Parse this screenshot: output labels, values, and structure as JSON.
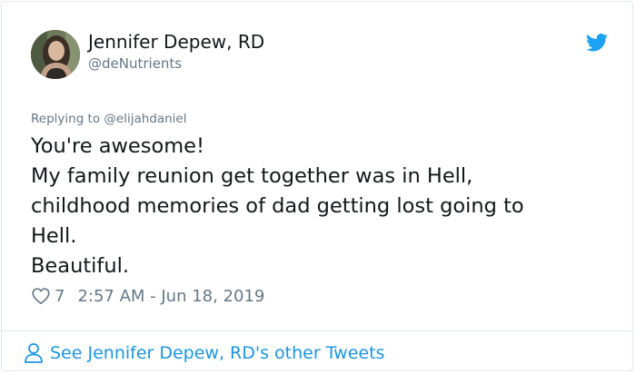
{
  "author": {
    "name": "Jennifer Depew, RD",
    "handle": "@deNutrients",
    "avatar_icon": "profile-photo"
  },
  "brand": {
    "icon": "twitter-bird-icon",
    "color": "#1da1f2"
  },
  "tweet": {
    "replying_to": "Replying to @elijahdaniel",
    "lines": [
      "You're awesome!",
      "My family reunion get together was in Hell,",
      "childhood memories of dad getting lost going to",
      "Hell.",
      "Beautiful."
    ]
  },
  "meta": {
    "like_icon": "heart-icon",
    "like_count": "7",
    "timestamp": "2:57 AM - Jun 18, 2019"
  },
  "footer": {
    "icon": "person-icon",
    "link_text": "See Jennifer Depew, RD's other Tweets",
    "link_color": "#1b95e0"
  },
  "colors": {
    "text": "#14171a",
    "secondary": "#657786",
    "border": "#e1e8ed"
  }
}
